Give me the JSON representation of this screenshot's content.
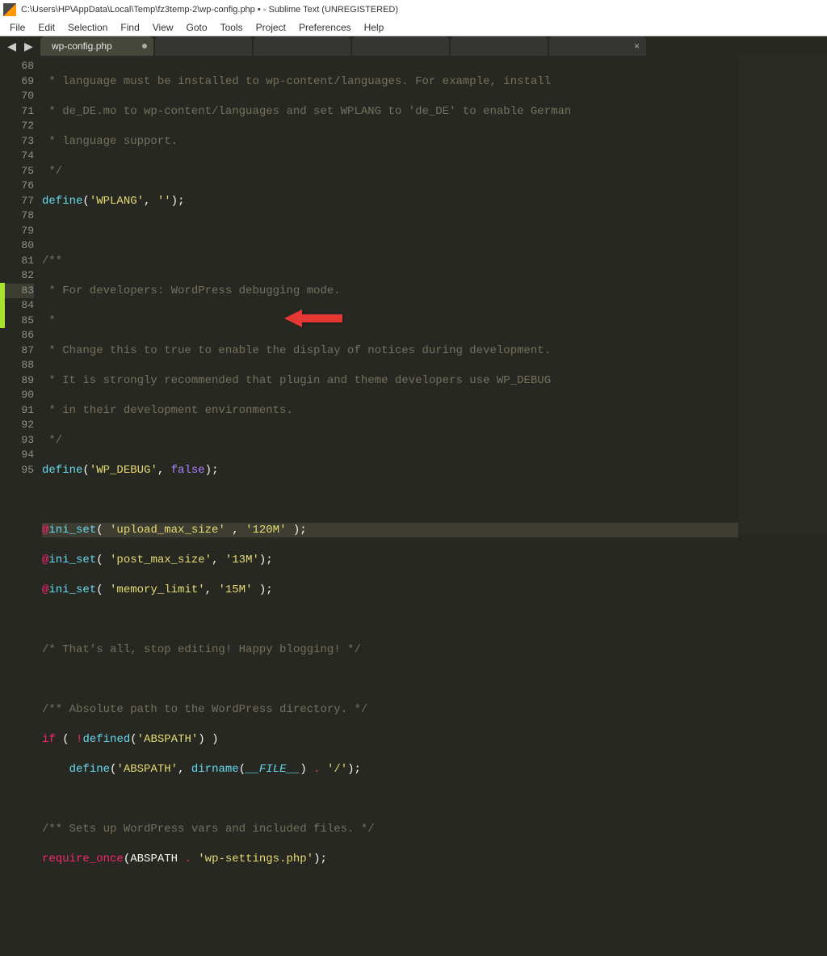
{
  "title": "C:\\Users\\HP\\AppData\\Local\\Temp\\fz3temp-2\\wp-config.php • - Sublime Text (UNREGISTERED)",
  "menu": [
    "File",
    "Edit",
    "Selection",
    "Find",
    "View",
    "Goto",
    "Tools",
    "Project",
    "Preferences",
    "Help"
  ],
  "tab_name": "wp-config.php",
  "lines": {
    "l68": " * language must be installed to wp-content/languages. For example, install",
    "l69": " * de_DE.mo to wp-content/languages and set WPLANG to 'de_DE' to enable German",
    "l70": " * language support.",
    "l71": " */",
    "l75": " * For developers: WordPress debugging mode.",
    "l76": " *",
    "l77": " * Change this to true to enable the display of notices during development.",
    "l78": " * It is strongly recommended that plugin and theme developers use WP_DEBUG",
    "l79": " * in their development environments.",
    "l80": " */",
    "l87": "/* That's all, stop editing! Happy blogging! */",
    "l89": "/** Absolute path to the WordPress directory. */",
    "l93": "/** Sets up WordPress vars and included files. */"
  },
  "tokens": {
    "define": "define",
    "wplang": "'WPLANG'",
    "empty": "''",
    "wpdebug": "'WP_DEBUG'",
    "false": "false",
    "iniset": "ini_set",
    "upload": "'upload_max_size'",
    "v120m": "'120M'",
    "post": "'post_max_size'",
    "v13m": "'13M'",
    "mem": "'memory_limit'",
    "v15m": "'15M'",
    "if": "if",
    "defined": "defined",
    "abspath_str": "'ABSPATH'",
    "abspath": "ABSPATH",
    "dirname": "dirname",
    "file": "__FILE__",
    "slash": "'/'",
    "require": "require_once",
    "wpsettings": "'wp-settings.php'",
    "cmopen": "/**",
    "at": "@",
    "not": "!",
    "dot": " . "
  }
}
